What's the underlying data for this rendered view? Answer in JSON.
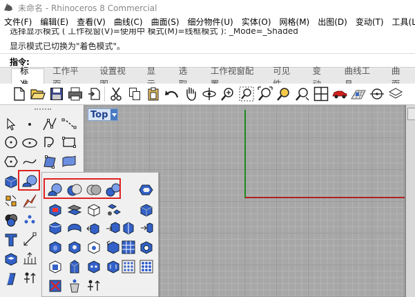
{
  "window": {
    "title": "未命名 - Rhinoceros 8 Commercial",
    "app_icon": "rhino-icon"
  },
  "menu": [
    "文件(F)",
    "编辑(E)",
    "查看(V)",
    "曲线(C)",
    "曲面(S)",
    "细分物件(U)",
    "实体(O)",
    "网格(M)",
    "出图(D)",
    "变动(T)",
    "工具(L"
  ],
  "command_history": {
    "line1": "选择显示模式 ( 工作视窗(V)=使用中 模式(M)=线框模式 ): _Mode=_Shaded",
    "line2": "显示模式已切换为\"着色模式\"。"
  },
  "command_prompt": "指令:",
  "tabs": [
    "标准",
    "工作平面",
    "设置视图",
    "显示",
    "选取",
    "工作视窗配置",
    "可见性",
    "变动",
    "曲线工具",
    "曲面"
  ],
  "active_tab": "标准",
  "toolbar_icons": [
    "new-file-icon",
    "open-file-icon",
    "save-icon",
    "print-icon",
    "import-icon",
    "cut-icon",
    "copy-icon",
    "paste-icon",
    "undo-icon",
    "pan-icon",
    "rotate-view-icon",
    "zoom-icon",
    "zoom-window-icon",
    "zoom-extents-icon",
    "zoom-selected-icon",
    "zoom-dynamic-icon",
    "four-viewports-icon",
    "car-icon",
    "perspective-grid-icon",
    "osnap-icon",
    "layers-icon"
  ],
  "viewport": {
    "name": "Top",
    "background": "#a7a7a7",
    "x_axis_color": "#b02020",
    "y_axis_color": "#1a8a1a"
  },
  "left_tools": [
    "select-arrow-icon",
    "point-icon",
    "polyline-icon",
    "curve-icon",
    "circle-icon",
    "ellipse-icon",
    "arc-icon",
    "rectangle-icon",
    "polygon-icon",
    "free-curve-icon",
    "surface-from-points-icon",
    "surface-patch-icon",
    "box-icon",
    "boolean-union-icon",
    "explode-icon",
    "split-icon",
    "mesh-sphere-icon",
    "points-cloud-icon",
    "text-icon",
    "dimension-icon",
    "solid-edit-icon",
    "array-icon",
    "extrude-icon",
    "transform-icon"
  ],
  "flyout_tools": [
    "boolean-union-flyout-icon",
    "boolean-difference-icon",
    "boolean-intersection-icon",
    "boolean-split-icon",
    "create-solid-icon",
    "cap-holes-icon",
    "extract-surface-icon",
    "merge-faces-icon",
    "wireframe-box-icon",
    "solid-box-icon",
    "fillet-edges-icon",
    "move-face-icon",
    "extrude-face-icon",
    "move-edge-icon",
    "split-face-icon",
    "shell-icon",
    "offset-solid-icon",
    "make-hole-icon",
    "rotate-hole-icon",
    "array-holes-icon",
    "solid-curve-icon",
    "solid-stand-icon",
    "tab-icon",
    "rib-icon",
    "dot-grid-icon",
    "delete-face-icon",
    "bucket-icon",
    "gumball-icon"
  ],
  "highlight_color": "#e02020"
}
